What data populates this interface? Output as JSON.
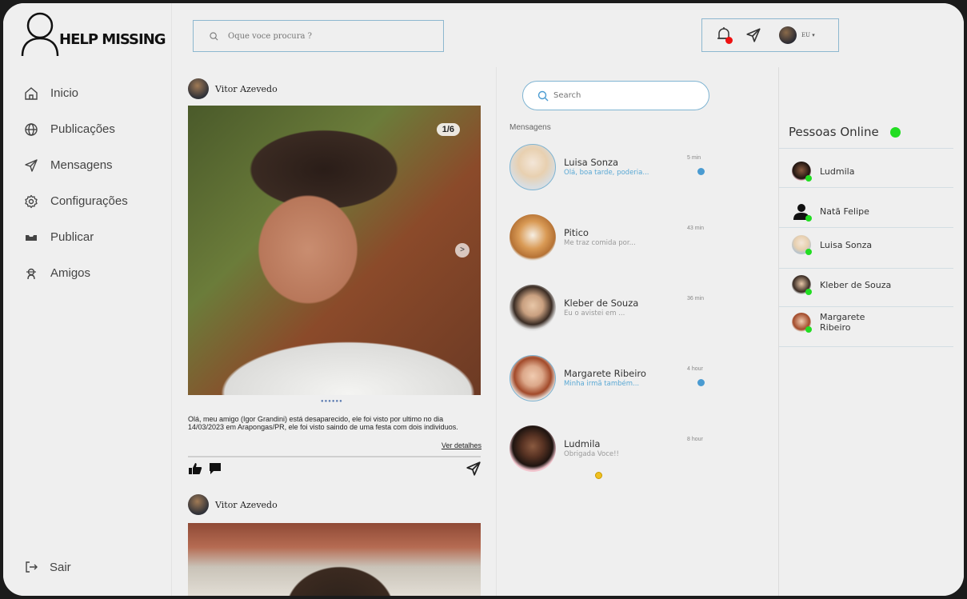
{
  "app": {
    "name": "HELP MISSING"
  },
  "sidebar": {
    "items": [
      {
        "label": "Inicio",
        "icon": "home-icon"
      },
      {
        "label": "Publicações",
        "icon": "globe-icon"
      },
      {
        "label": "Mensagens",
        "icon": "send-icon"
      },
      {
        "label": "Configurações",
        "icon": "gear-icon"
      },
      {
        "label": "Publicar",
        "icon": "tray-icon"
      },
      {
        "label": "Amigos",
        "icon": "friends-icon"
      }
    ],
    "logout": "Sair"
  },
  "topbar": {
    "search_placeholder": "Oque voce procura ?",
    "user_label": "EU",
    "notification_badge_color": "#e11111"
  },
  "feed": {
    "posts": [
      {
        "author": "Vitor Azevedo",
        "counter": "1/6",
        "caption": "Olá, meu amigo (Igor Grandini)  está desaparecido, ele foi visto por ultimo no dia 14/03/2023 em Arapongas/PR, ele foi visto saindo de uma festa com dois individuos.",
        "details_link": "Ver detalhes"
      },
      {
        "author": "Vitor Azevedo"
      }
    ]
  },
  "messages": {
    "search_placeholder": "Search",
    "section_label": "Mensagens",
    "items": [
      {
        "name": "Luisa Sonza",
        "preview": "Olá, boa tarde, poderia...",
        "time": "5 min",
        "unread": true
      },
      {
        "name": "Pitico",
        "preview": "Me traz comida por...",
        "time": "43 min",
        "unread": false
      },
      {
        "name": "Kleber de Souza",
        "preview": "Eu o avistei em ...",
        "time": "36 min",
        "unread": false
      },
      {
        "name": "Margarete Ribeiro",
        "preview": "Minha irmã também...",
        "time": "4 hour",
        "unread": true
      },
      {
        "name": "Ludmila",
        "preview": "Obrigada Voce!!",
        "time": "8 hour",
        "unread": false
      }
    ]
  },
  "online": {
    "title": "Pessoas Online",
    "status_color": "#22dd22",
    "people": [
      {
        "name": "Ludmila"
      },
      {
        "name": "Natã Felipe"
      },
      {
        "name": "Luisa Sonza"
      },
      {
        "name": "Kleber de Souza"
      },
      {
        "name": "Margarete",
        "name_line2": "Ribeiro"
      }
    ]
  }
}
